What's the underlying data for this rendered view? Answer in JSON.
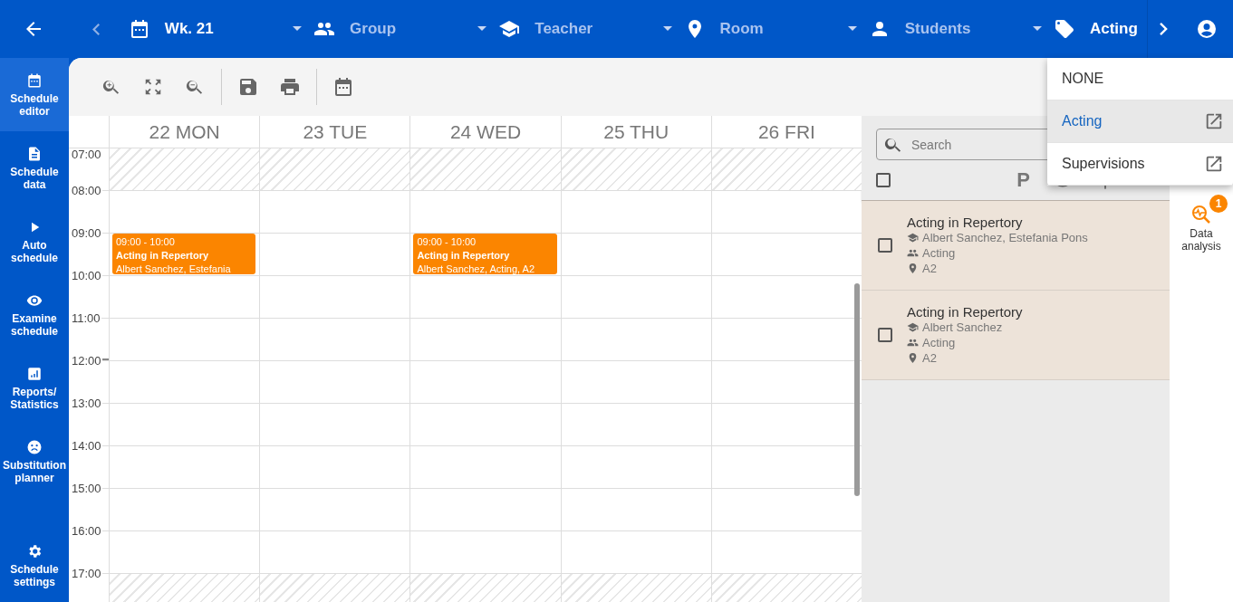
{
  "top_bar": {
    "filters": [
      {
        "kind": "week",
        "label": "Wk. 21",
        "active": true
      },
      {
        "kind": "group",
        "label": "Group",
        "active": false
      },
      {
        "kind": "teacher",
        "label": "Teacher",
        "active": false
      },
      {
        "kind": "room",
        "label": "Room",
        "active": false
      },
      {
        "kind": "student",
        "label": "Students",
        "active": false
      },
      {
        "kind": "tag",
        "label": "Acting",
        "active": true
      }
    ]
  },
  "sidebar": {
    "items": [
      {
        "label": "Schedule editor",
        "selected": true
      },
      {
        "label": "Schedule data",
        "selected": false
      },
      {
        "label": "Auto schedule",
        "selected": false
      },
      {
        "label": "Examine schedule",
        "selected": false
      },
      {
        "label": "Reports/ Statistics",
        "selected": false
      },
      {
        "label": "Substitution planner",
        "selected": false
      }
    ],
    "bottom_item": {
      "label": "Schedule settings",
      "selected": false
    }
  },
  "calendar": {
    "days": [
      {
        "label": "22 MON",
        "events": [
          {
            "time": "09:00 - 10:00",
            "title": "Acting in Repertory",
            "details": "Albert Sanchez, Estefania"
          }
        ]
      },
      {
        "label": "23 TUE"
      },
      {
        "label": "24 WED",
        "events": [
          {
            "time": "09:00 - 10:00",
            "title": "Acting in Repertory",
            "details": "Albert Sanchez, Acting, A2"
          }
        ]
      },
      {
        "label": "25 THU"
      },
      {
        "label": "26 FRI"
      }
    ],
    "hours": [
      {
        "label": "07:00",
        "blocked": true
      },
      {
        "label": "08:00",
        "blocked": false
      },
      {
        "label": "09:00",
        "blocked": false
      },
      {
        "label": "10:00",
        "blocked": false
      },
      {
        "label": "11:00",
        "blocked": false
      },
      {
        "label": "12:00",
        "blocked": false
      },
      {
        "label": "13:00",
        "blocked": false
      },
      {
        "label": "14:00",
        "blocked": false
      },
      {
        "label": "15:00",
        "blocked": false
      },
      {
        "label": "16:00",
        "blocked": false
      },
      {
        "label": "17:00",
        "blocked": true
      }
    ]
  },
  "lessons_panel": {
    "search": {
      "placeholder": "Search"
    },
    "select_all_checked": false,
    "pinned_label": "P",
    "lessons": [
      {
        "title": "Acting in Repertory",
        "teacher": "Albert Sanchez, Estefania Pons",
        "group": "Acting",
        "room": "A2",
        "checked": false
      },
      {
        "title": "Acting in Repertory",
        "teacher": "Albert Sanchez",
        "group": "Acting",
        "room": "A2",
        "checked": false
      }
    ]
  },
  "right_rail": {
    "label": "Data analysis",
    "badge": "1"
  },
  "dropdown_menu": {
    "items": [
      {
        "label": "NONE",
        "selected": false,
        "external": false
      },
      {
        "label": "Acting",
        "selected": true,
        "external": true
      },
      {
        "label": "Supervisions",
        "selected": false,
        "external": true
      }
    ]
  }
}
